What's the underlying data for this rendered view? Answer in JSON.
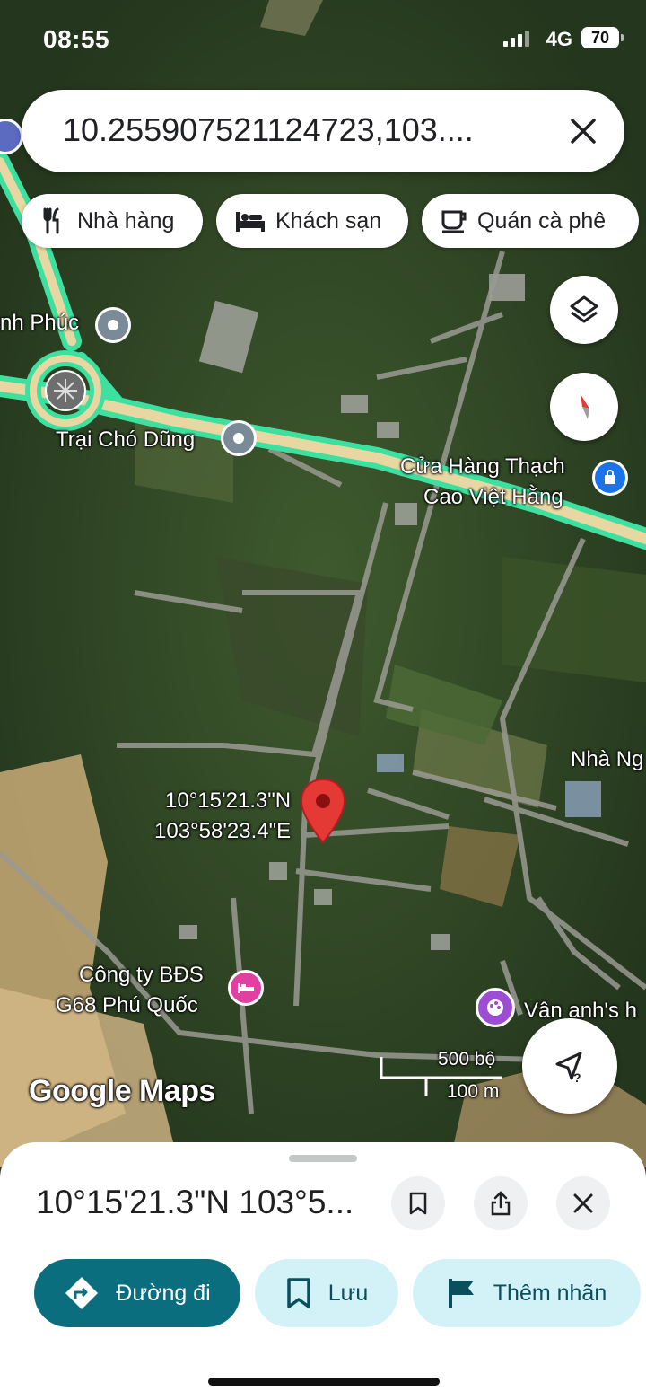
{
  "status": {
    "time": "08:55",
    "network": "4G",
    "battery": "70"
  },
  "search": {
    "query": "10.255907521124723,103...."
  },
  "chips": [
    {
      "label": "Nhà hàng",
      "icon": "restaurant-icon"
    },
    {
      "label": "Khách sạn",
      "icon": "hotel-icon"
    },
    {
      "label": "Quán cà phê",
      "icon": "coffee-icon"
    }
  ],
  "map": {
    "labels": {
      "place_left": "nh Phúc",
      "trai_cho": "Trại Chó Dũng",
      "cua_hang_1": "Cửa Hàng Thạch",
      "cua_hang_2": "Cao Việt Hằng",
      "nha_ng": "Nhà Ng",
      "pin_lat": "10°15'21.3\"N",
      "pin_lng": "103°58'23.4\"E",
      "cong_ty_1": "Công ty BĐS",
      "cong_ty_2": "G68 Phú Quốc",
      "van_anh": "Vân anh's h"
    },
    "scale": {
      "feet": "500 bộ",
      "meters": "100 m"
    },
    "logo": "Google Maps",
    "colors": {
      "highway": "#3ee0a0",
      "pin": "#e53935"
    }
  },
  "sheet": {
    "title": "10°15'21.3\"N 103°5...",
    "directions": "Đường đi",
    "save": "Lưu",
    "label": "Thêm nhãn",
    "accent": "#0b6e7f"
  }
}
